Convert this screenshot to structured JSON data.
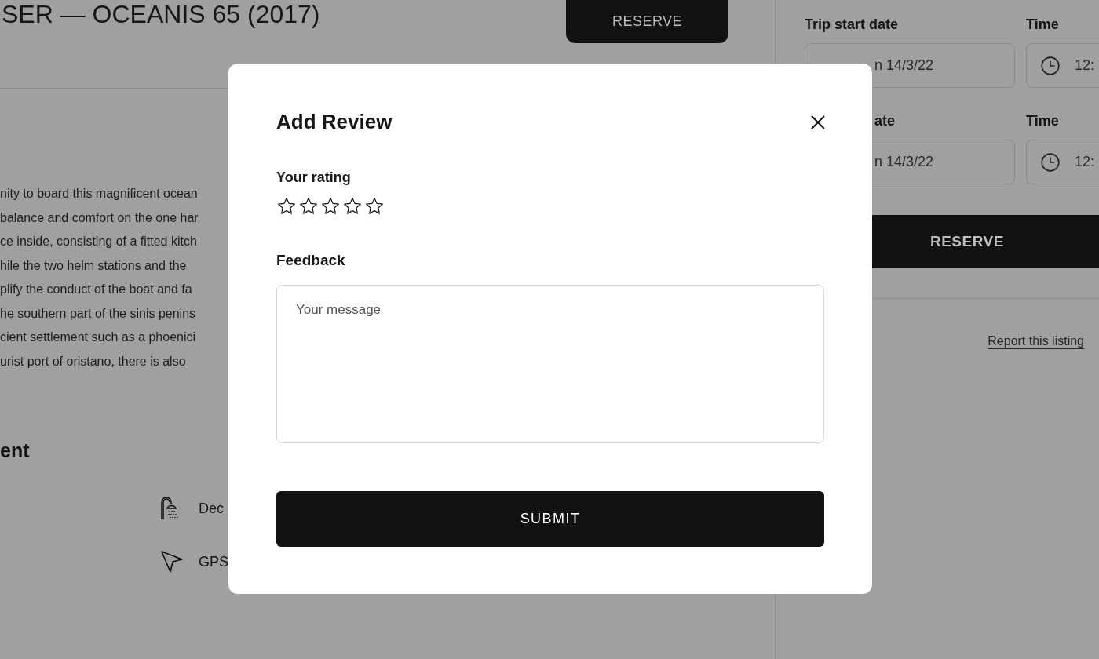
{
  "listing": {
    "title": "SER — OCEANIS 65 (2017)",
    "reserve_button": "RESERVE",
    "description_lines": [
      "nity to board this magnificent ocean",
      "balance and comfort on the one har",
      "ce inside, consisting of a fitted kitch",
      "hile the two helm stations and the",
      "plify the conduct of the boat and fa",
      "he southern part of the sinis penins",
      "cient settlement such as a phoenici",
      "urist port of oristano, there is also"
    ],
    "equipment_heading": "ent",
    "equipment": [
      {
        "kind": "shower",
        "label": "Dec"
      },
      {
        "kind": "gps",
        "label": "GPS"
      }
    ]
  },
  "booking": {
    "start_date_label": "Trip start date",
    "start_time_label": "Time",
    "start_date": "n 14/3/22",
    "start_time": "12:",
    "end_date_label": "ate",
    "end_time_label": "Time",
    "end_date": "n 14/3/22",
    "end_time": "12:",
    "reserve_button": "RESERVE",
    "report_link": "Report this listing"
  },
  "dialog": {
    "title": "Add Review",
    "rating_label": "Your rating",
    "stars": 0,
    "feedback_label": "Feedback",
    "feedback_placeholder": "Your message",
    "submit_button": "SUBMIT"
  }
}
